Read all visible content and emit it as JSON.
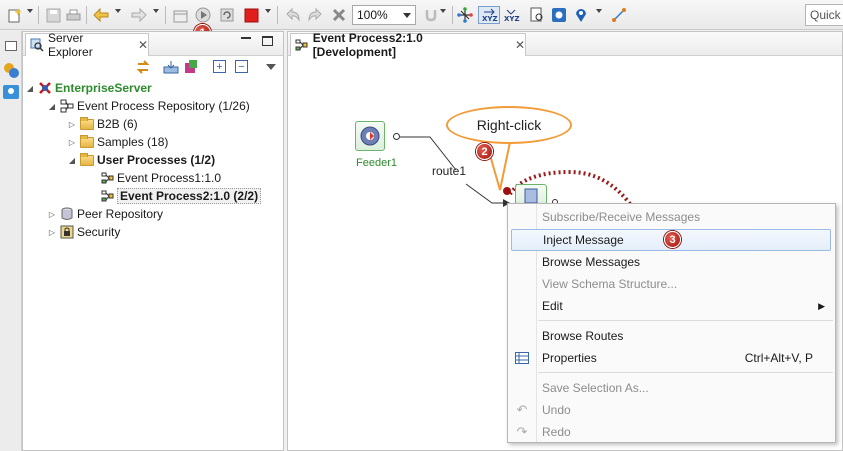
{
  "toolbar": {
    "zoom_value": "100%",
    "quick_access": "Quick Access",
    "step1_badge": "1"
  },
  "explorer": {
    "tab_title": "Server Explorer",
    "tree": [
      {
        "label": "EnterpriseServer"
      },
      {
        "label": "Event Process Repository (1/26)"
      },
      {
        "label": "B2B (6)"
      },
      {
        "label": "Samples (18)"
      },
      {
        "label": "User Processes (1/2)"
      },
      {
        "label": "Event Process1:1.0"
      },
      {
        "label": "Event Process2:1.0 (2/2)"
      },
      {
        "label": "Peer Repository"
      },
      {
        "label": "Security"
      }
    ]
  },
  "editor": {
    "tab_title": "Event Process2:1.0 [Development]",
    "feeder_label": "Feeder1",
    "route_label": "route1",
    "callout_text": "Right-click",
    "step2_badge": "2",
    "step3_badge": "3"
  },
  "context_menu": {
    "items": [
      {
        "label": "Subscribe/Receive Messages",
        "enabled": false
      },
      {
        "label": "Inject Message",
        "enabled": true,
        "highlighted": true
      },
      {
        "label": "Browse Messages",
        "enabled": true
      },
      {
        "label": "View Schema Structure...",
        "enabled": false
      },
      {
        "label": "Edit",
        "enabled": true,
        "submenu": true
      },
      {
        "label": "Browse Routes",
        "enabled": true
      },
      {
        "label": "Properties",
        "enabled": true,
        "accelerator": "Ctrl+Alt+V, P"
      },
      {
        "label": "Save Selection As...",
        "enabled": false
      },
      {
        "label": "Undo",
        "enabled": false
      },
      {
        "label": "Redo",
        "enabled": false
      }
    ]
  },
  "colors": {
    "annotation_orange": "#f29b37",
    "arrow_red": "#9b1c1c",
    "node_green": "#2e8b2e",
    "badge_red": "#c0281e",
    "menu_highlight_border": "#99bce6"
  }
}
